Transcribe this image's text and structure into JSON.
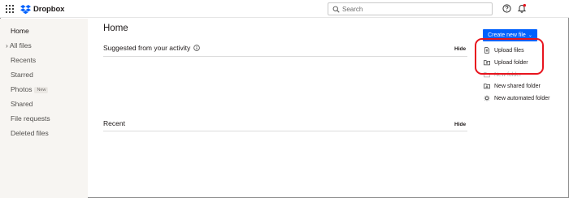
{
  "topbar": {
    "logo_text": "Dropbox",
    "search_placeholder": "Search"
  },
  "sidebar": {
    "items": [
      {
        "label": "Home",
        "active": true
      },
      {
        "label": "All files",
        "prefix": "›"
      },
      {
        "label": "Recents"
      },
      {
        "label": "Starred"
      },
      {
        "label": "Photos",
        "badge": "New"
      },
      {
        "label": "Shared"
      },
      {
        "label": "File requests"
      },
      {
        "label": "Deleted files"
      }
    ]
  },
  "main": {
    "title": "Home",
    "create_button": "Create new file",
    "suggested": {
      "title": "Suggested from your activity",
      "hide": "Hide"
    },
    "recent": {
      "title": "Recent",
      "hide": "Hide"
    }
  },
  "menu": {
    "items": [
      {
        "label": "Upload files",
        "icon": "file-upload-icon"
      },
      {
        "label": "Upload folder",
        "icon": "folder-upload-icon"
      },
      {
        "label": "New folder",
        "icon": "new-folder-icon"
      },
      {
        "label": "New shared folder",
        "icon": "shared-folder-icon"
      },
      {
        "label": "New automated folder",
        "icon": "automated-folder-icon"
      }
    ]
  },
  "colors": {
    "brand_blue": "#0061fe",
    "highlight_red": "#e8141e",
    "sidebar_bg": "#f7f5f2"
  }
}
